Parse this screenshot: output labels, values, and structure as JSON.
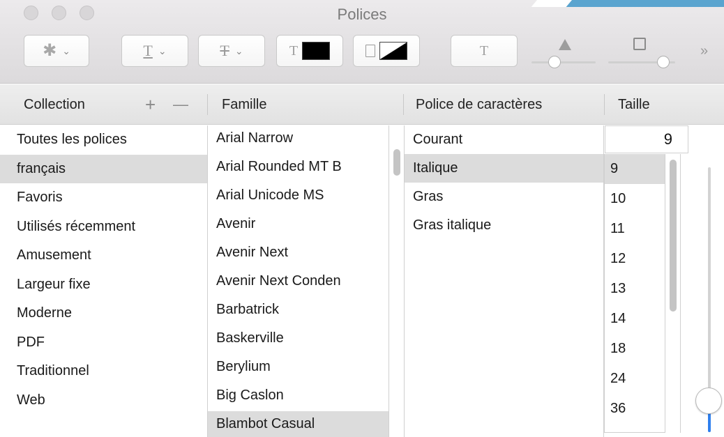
{
  "window": {
    "title": "Polices"
  },
  "toolbar": {
    "action_icon": "gear-icon",
    "underline_glyph": "T",
    "strike_glyph": "T",
    "text_color_glyph": "T",
    "text_color": "#000000",
    "shadow_glyph": "T",
    "chevron": "⌄",
    "more": "»"
  },
  "headers": {
    "collection": "Collection",
    "add": "+",
    "remove": "—",
    "family": "Famille",
    "typeface": "Police de caractères",
    "size": "Taille"
  },
  "collections": {
    "selected_index": 1,
    "items": [
      "Toutes les polices",
      "français",
      "Favoris",
      "Utilisés récemment",
      "Amusement",
      "Largeur fixe",
      "Moderne",
      "PDF",
      "Traditionnel",
      "Web"
    ]
  },
  "families": {
    "selected_index": 10,
    "items": [
      "Arial Narrow",
      "Arial Rounded MT B",
      "Arial Unicode MS",
      "Avenir",
      "Avenir Next",
      "Avenir Next Conden",
      "Barbatrick",
      "Baskerville",
      "Berylium",
      "Big Caslon",
      "Blambot Casual"
    ]
  },
  "typefaces": {
    "selected_index": 1,
    "items": [
      "Courant",
      "Italique",
      "Gras",
      "Gras italique"
    ]
  },
  "sizes": {
    "current_value": "9",
    "selected_index": 0,
    "items": [
      "9",
      "10",
      "11",
      "12",
      "13",
      "14",
      "18",
      "24",
      "36"
    ]
  }
}
